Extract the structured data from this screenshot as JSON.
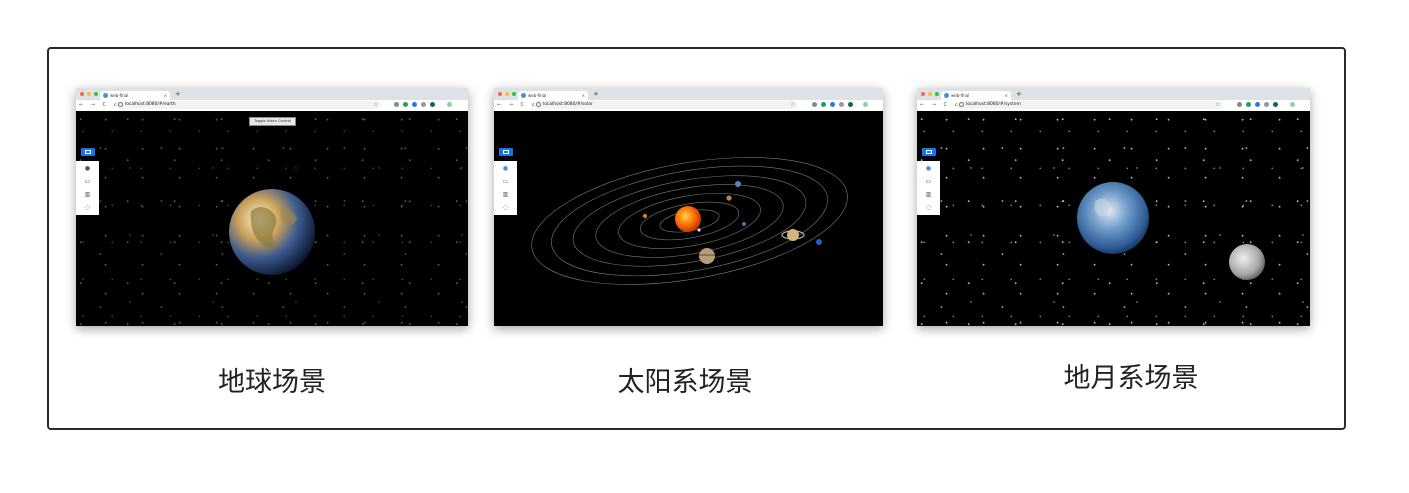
{
  "panels": [
    {
      "caption": "地球场景",
      "tab_title": "web-final",
      "url": "localhost:8080/#/earth",
      "tooltip": "Toggle Video Control",
      "scene": "earth"
    },
    {
      "caption": "太阳系场景",
      "tab_title": "web-final",
      "url": "localhost:8080/#/solar",
      "scene": "solar"
    },
    {
      "caption": "地月系场景",
      "tab_title": "web-final",
      "url": "localhost:8080/#/system",
      "scene": "earth-moon"
    }
  ],
  "browser": {
    "tab_close": "×",
    "new_tab": "+",
    "nav_buttons": "← → C ⌂",
    "star": "☆"
  },
  "colors": {
    "accent": "#1a73e8",
    "traffic_red": "#ff5f57",
    "traffic_yellow": "#febc2e",
    "traffic_green": "#28c840",
    "sun": "#ff6a00",
    "orbit": "#7a7a7a"
  },
  "icons": {
    "menu": "menu-icon",
    "side": [
      "globe-icon",
      "monitor-icon",
      "chart-icon",
      "info-icon"
    ]
  }
}
